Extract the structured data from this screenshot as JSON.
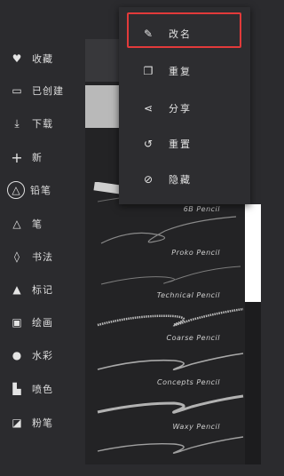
{
  "sidebar": {
    "items": [
      {
        "icon": "heart-icon",
        "glyph": "♥",
        "label": "收藏"
      },
      {
        "icon": "folder-icon",
        "glyph": "▭",
        "label": "已创建"
      },
      {
        "icon": "download-icon",
        "glyph": "⤓",
        "label": "下载"
      },
      {
        "icon": "plus-icon",
        "glyph": "+",
        "label": "新"
      },
      {
        "icon": "pencil-icon",
        "glyph": "△",
        "label": "铅笔"
      },
      {
        "icon": "pen-icon",
        "glyph": "△",
        "label": "笔"
      },
      {
        "icon": "calligraphy-icon",
        "glyph": "◊",
        "label": "书法"
      },
      {
        "icon": "marker-icon",
        "glyph": "▲",
        "label": "标记"
      },
      {
        "icon": "paint-icon",
        "glyph": "▣",
        "label": "绘画"
      },
      {
        "icon": "watercolor-icon",
        "glyph": "●",
        "label": "水彩"
      },
      {
        "icon": "spray-icon",
        "glyph": "▙",
        "label": "喷色"
      },
      {
        "icon": "crayon-icon",
        "glyph": "◪",
        "label": "粉笔"
      }
    ]
  },
  "brushes": [
    {
      "name": "6B Pencil"
    },
    {
      "name": "Proko Pencil"
    },
    {
      "name": "Technical Pencil"
    },
    {
      "name": "Coarse Pencil"
    },
    {
      "name": "Concepts Pencil"
    },
    {
      "name": "Waxy Pencil"
    }
  ],
  "menu": {
    "items": [
      {
        "icon": "edit-icon",
        "glyph": "✎",
        "label": "改名"
      },
      {
        "icon": "duplicate-icon",
        "glyph": "❐",
        "label": "重复"
      },
      {
        "icon": "share-icon",
        "glyph": "⋖",
        "label": "分享"
      },
      {
        "icon": "reset-icon",
        "glyph": "↺",
        "label": "重置"
      },
      {
        "icon": "hide-icon",
        "glyph": "⊘",
        "label": "隐藏"
      }
    ]
  },
  "colors": {
    "highlight": "#e23a3a",
    "panel": "#2d2d30",
    "background": "#2b2b2e"
  }
}
